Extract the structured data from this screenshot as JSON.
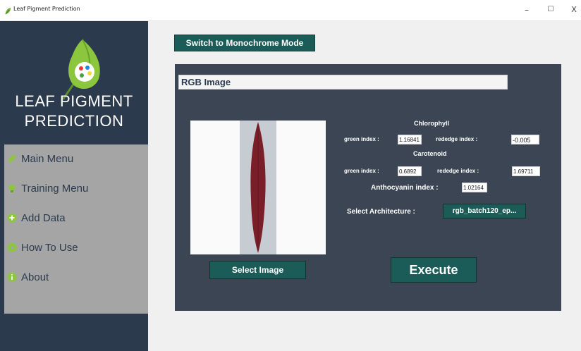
{
  "window": {
    "title": "Leaf Pigment Prediction",
    "minimize_glyph": "–",
    "maximize_glyph": "☐",
    "close_glyph": "X"
  },
  "sidebar": {
    "brand_line1": "LEAF PIGMENT",
    "brand_line2": "PREDICTION",
    "items": [
      {
        "label": "Main Menu",
        "icon": "leaf-icon",
        "icon_color": "#8cc63f"
      },
      {
        "label": "Training Menu",
        "icon": "bulb-icon",
        "icon_color": "#8cc63f"
      },
      {
        "label": "Add Data",
        "icon": "plus-icon",
        "icon_color": "#8cc63f"
      },
      {
        "label": "How To Use",
        "icon": "help-icon",
        "icon_color": "#8cc63f"
      },
      {
        "label": "About",
        "icon": "info-icon",
        "icon_color": "#8cc63f"
      }
    ]
  },
  "main": {
    "mono_button": "Switch to Monochrome Mode",
    "panel_header": "RGB Image",
    "select_image_button": "Select Image",
    "chlorophyll": {
      "heading": "Chlorophyll",
      "green_label": "green index :",
      "green_value": "1.16841",
      "rededge_label": "rededge index :",
      "rededge_value": "-0.005"
    },
    "carotenoid": {
      "heading": "Carotenoid",
      "green_label": "green index :",
      "green_value": "0.6892",
      "rededge_label": "rededge index :",
      "rededge_value": "1.69711"
    },
    "anthocyanin": {
      "label": "Anthocyanin index :",
      "value": "1.02164"
    },
    "architecture": {
      "label": "Select Architecture :",
      "value": "rgb_batch120_ep..."
    },
    "execute_button": "Execute"
  },
  "colors": {
    "sidebar_bg": "#2c3a4d",
    "menu_bg": "#a5a5a5",
    "button_bg": "#1c5c58",
    "panel_bg": "#3b4553",
    "leaf_color": "#7a1f2a"
  }
}
